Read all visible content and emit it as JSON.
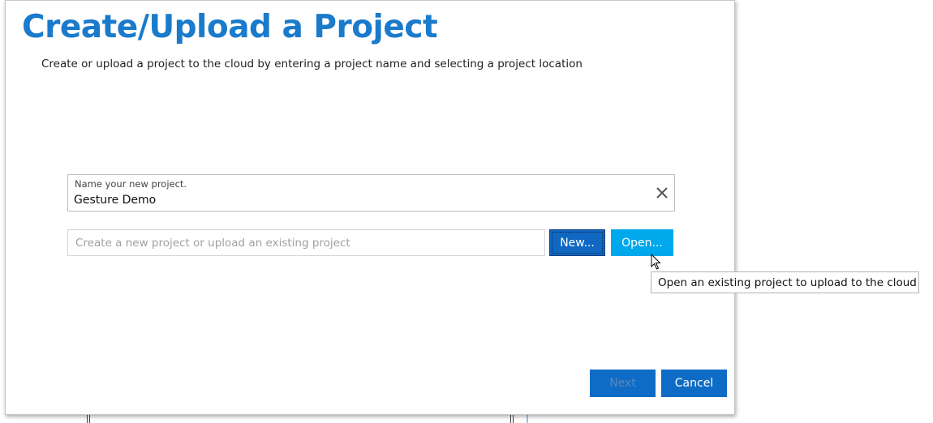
{
  "dialog": {
    "title": "Create/Upload a Project",
    "subtitle": "Create or upload a project to the cloud by entering a project name and selecting a project location"
  },
  "project_name": {
    "label": "Name your new project.",
    "value": "Gesture Demo",
    "clear_icon": "close-icon"
  },
  "location": {
    "placeholder": "Create a new project or upload an existing project",
    "value": ""
  },
  "buttons": {
    "new_label": "New...",
    "open_label": "Open...",
    "next_label": "Next",
    "cancel_label": "Cancel"
  },
  "tooltip": {
    "text": "Open an existing project to upload to the cloud"
  },
  "colors": {
    "title": "#1a7acb",
    "primary_button": "#0f6cc6",
    "open_button": "#00a8ec"
  }
}
